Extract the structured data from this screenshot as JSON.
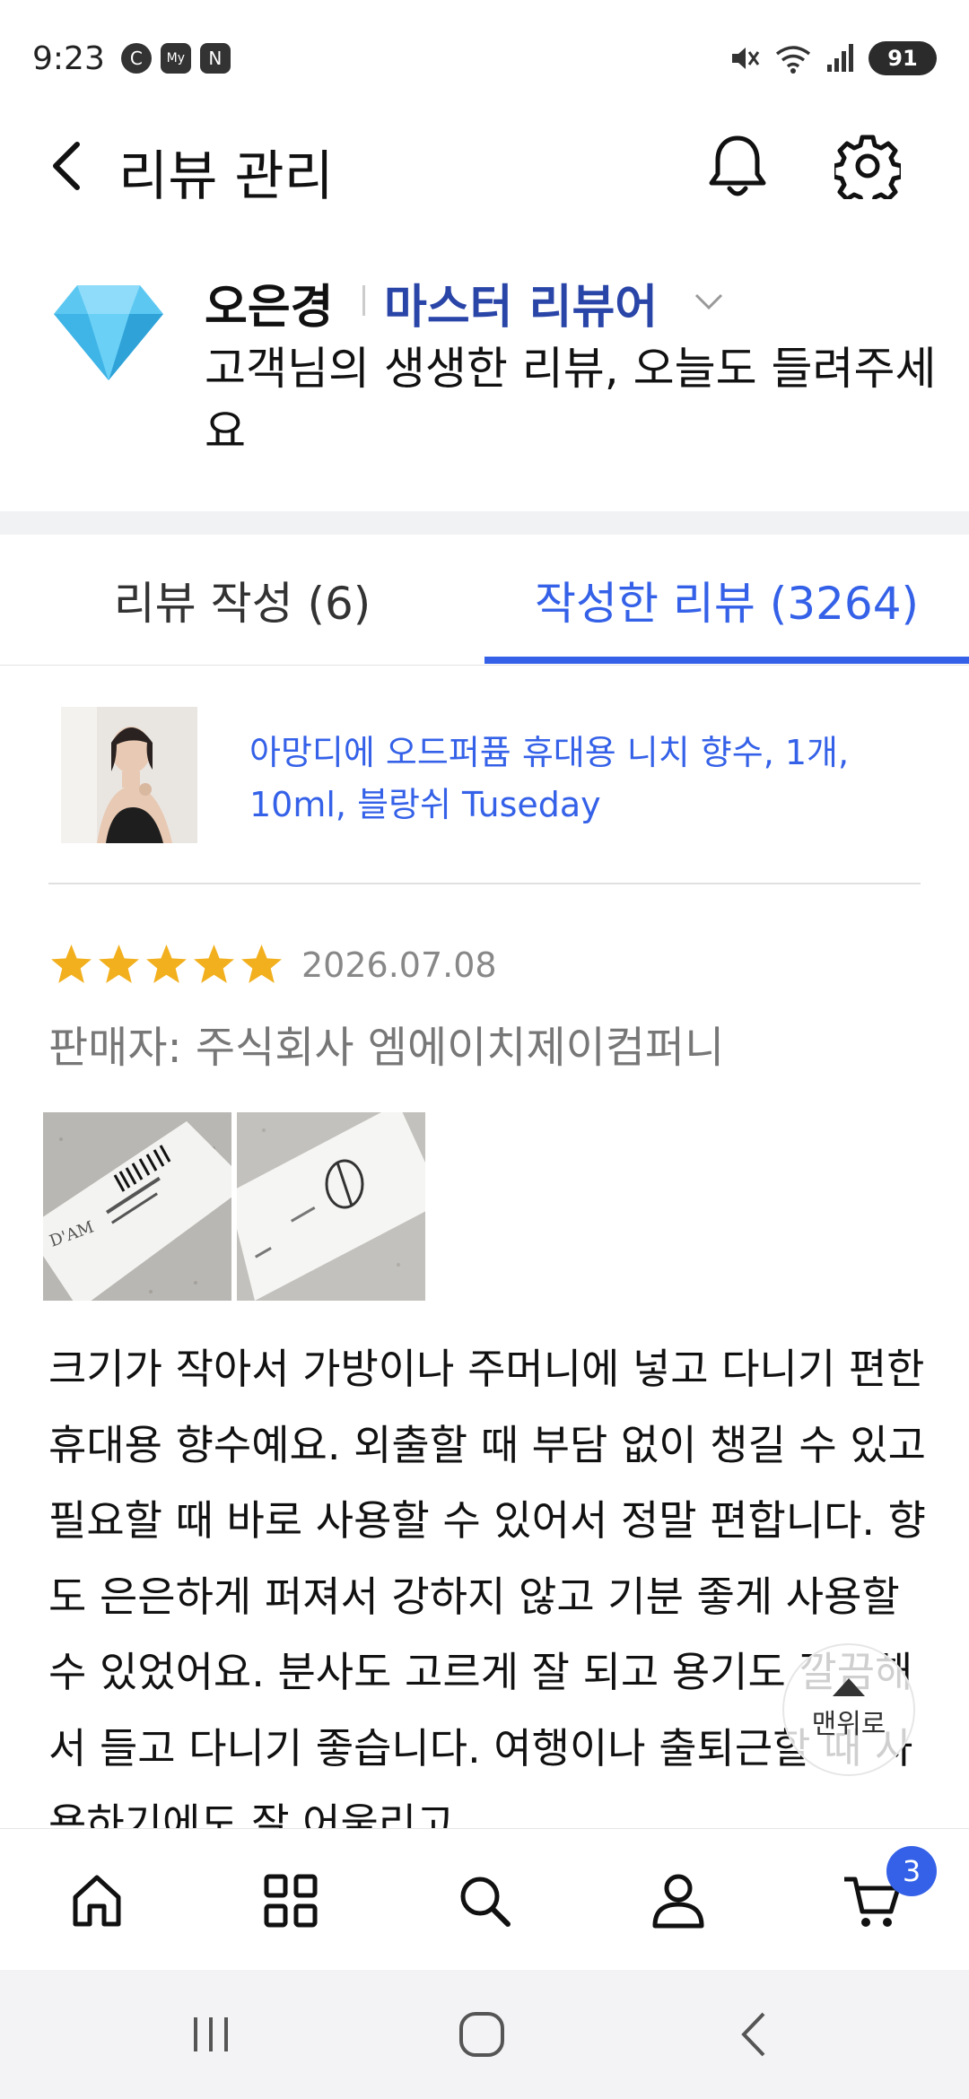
{
  "status_bar": {
    "time": "9:23",
    "mini_icons": [
      "C",
      "My",
      "N"
    ],
    "battery": "91"
  },
  "header": {
    "title": "리뷰 관리"
  },
  "profile": {
    "name": "오은경",
    "grade": "마스터 리뷰어",
    "message": "고객님의 생생한 리뷰, 오늘도 들려주세요"
  },
  "tabs": [
    {
      "label": "리뷰 작성 (6)",
      "active": false
    },
    {
      "label": "작성한 리뷰 (3264)",
      "active": true
    }
  ],
  "product": {
    "name": "아망디에 오드퍼퓸 휴대용 니치 향수, 1개, 10ml, 블랑쉬 Tuseday"
  },
  "review": {
    "rating": 5,
    "date": "2026.07.08",
    "seller": "판매자: 주식회사 엠에이치제이컴퍼니",
    "text": "크기가 작아서 가방이나 주머니에 넣고 다니기 편한 휴대용 향수예요. 외출할 때 부담 없이 챙길 수 있고 필요할 때 바로 사용할 수 있어서 정말 편합니다. 향도 은은하게 퍼져서 강하지 않고 기분 좋게 사용할 수 있었어요. 분사도 고르게 잘 되고 용기도 깔끔해서 들고 다니기 좋습니다. 여행이나 출퇴근할 때 사용하기에도 잘 어울리고"
  },
  "scroll_top": {
    "label": "맨위로"
  },
  "bottom_nav": {
    "items": [
      "home-icon",
      "category-icon",
      "search-icon",
      "user-icon",
      "cart-icon"
    ],
    "cart_count": "3"
  },
  "colors": {
    "accent": "#3461e8",
    "grade": "#2a45a8",
    "star": "#f2b01e"
  }
}
